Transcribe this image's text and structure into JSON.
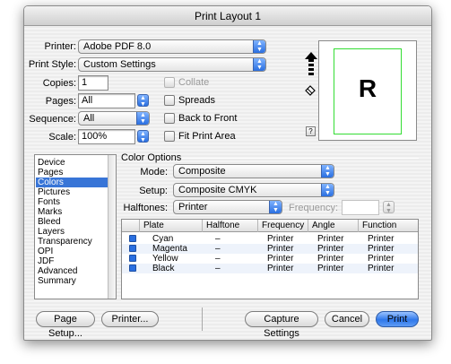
{
  "window": {
    "title": "Print Layout 1"
  },
  "printer": {
    "label": "Printer:",
    "value": "Adobe PDF 8.0"
  },
  "print_style": {
    "label": "Print Style:",
    "value": "Custom Settings"
  },
  "copies": {
    "label": "Copies:",
    "value": "1"
  },
  "pages": {
    "label": "Pages:",
    "value": "All"
  },
  "sequence": {
    "label": "Sequence:",
    "value": "All"
  },
  "scale": {
    "label": "Scale:",
    "value": "100%"
  },
  "options": {
    "collate": "Collate",
    "spreads": "Spreads",
    "back_to_front": "Back to Front",
    "fit_print_area": "Fit Print Area"
  },
  "preview": {
    "letter": "R",
    "help": "?"
  },
  "nav": {
    "items": [
      "Device",
      "Pages",
      "Colors",
      "Pictures",
      "Fonts",
      "Marks",
      "Bleed",
      "Layers",
      "Transparency",
      "OPI",
      "JDF",
      "Advanced",
      "Summary"
    ],
    "selected": "Colors"
  },
  "color_options": {
    "title": "Color Options",
    "mode_label": "Mode:",
    "mode_value": "Composite",
    "setup_label": "Setup:",
    "setup_value": "Composite CMYK",
    "halftones_label": "Halftones:",
    "halftones_value": "Printer",
    "frequency_label": "Frequency:"
  },
  "plates_table": {
    "columns": [
      "Plate",
      "Halftone",
      "Frequency",
      "Angle",
      "Function"
    ],
    "rows": [
      [
        "Cyan",
        "–",
        "Printer",
        "Printer",
        "Printer"
      ],
      [
        "Magenta",
        "–",
        "Printer",
        "Printer",
        "Printer"
      ],
      [
        "Yellow",
        "–",
        "Printer",
        "Printer",
        "Printer"
      ],
      [
        "Black",
        "–",
        "Printer",
        "Printer",
        "Printer"
      ]
    ]
  },
  "buttons": {
    "page_setup": "Page Setup...",
    "printer": "Printer...",
    "capture_settings": "Capture Settings",
    "cancel": "Cancel",
    "print": "Print"
  },
  "colors": {
    "accent": "#2f78ea",
    "selection": "#3875d7",
    "preview_page_border": "#33dd33"
  }
}
